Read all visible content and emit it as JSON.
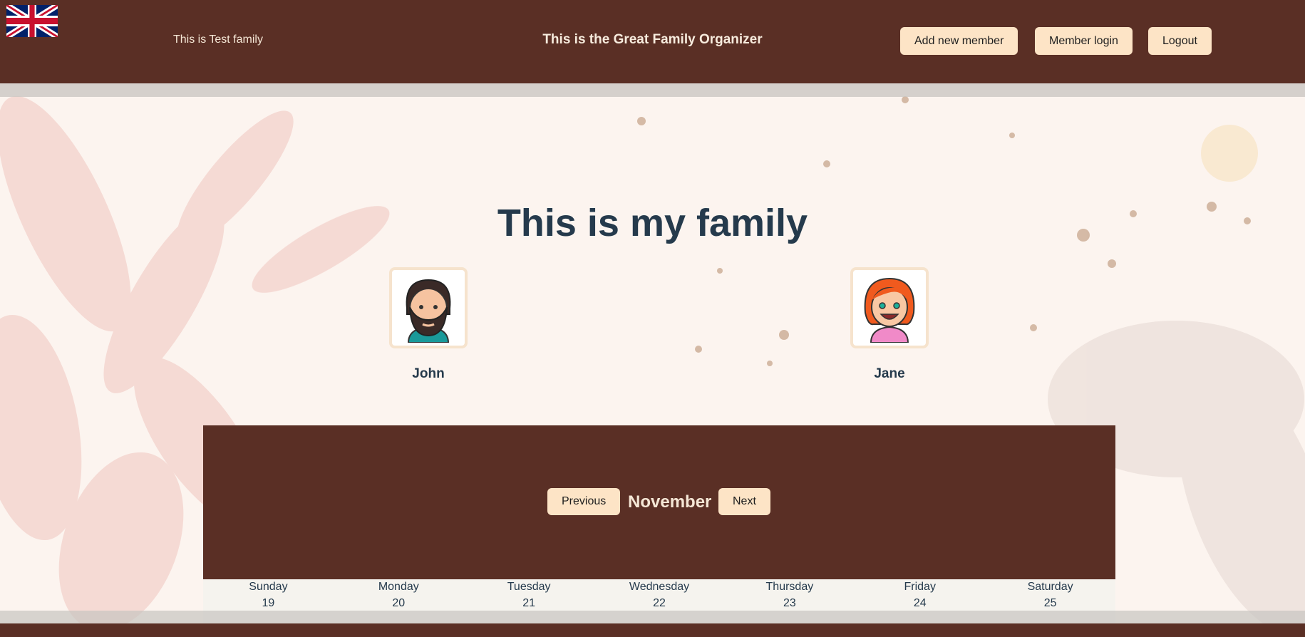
{
  "header": {
    "family_label": "This is Test family",
    "app_title": "This is the Great Family Organizer",
    "add_member_label": "Add new member",
    "member_login_label": "Member login",
    "logout_label": "Logout",
    "flag_icon": "uk-flag-icon"
  },
  "main": {
    "heading": "This is my family",
    "members": [
      {
        "name": "John",
        "avatar": "bearded-man-avatar"
      },
      {
        "name": "Jane",
        "avatar": "red-hair-woman-avatar"
      }
    ]
  },
  "calendar": {
    "prev_label": "Previous",
    "month": "November",
    "next_label": "Next",
    "days": [
      {
        "name": "Sunday",
        "date": "19"
      },
      {
        "name": "Monday",
        "date": "20"
      },
      {
        "name": "Tuesday",
        "date": "21"
      },
      {
        "name": "Wednesday",
        "date": "22"
      },
      {
        "name": "Thursday",
        "date": "23"
      },
      {
        "name": "Friday",
        "date": "24"
      },
      {
        "name": "Saturday",
        "date": "25"
      }
    ]
  },
  "colors": {
    "header_bg": "#5a2f25",
    "button_bg": "#fde4c6",
    "heading_text": "#253a4c"
  }
}
